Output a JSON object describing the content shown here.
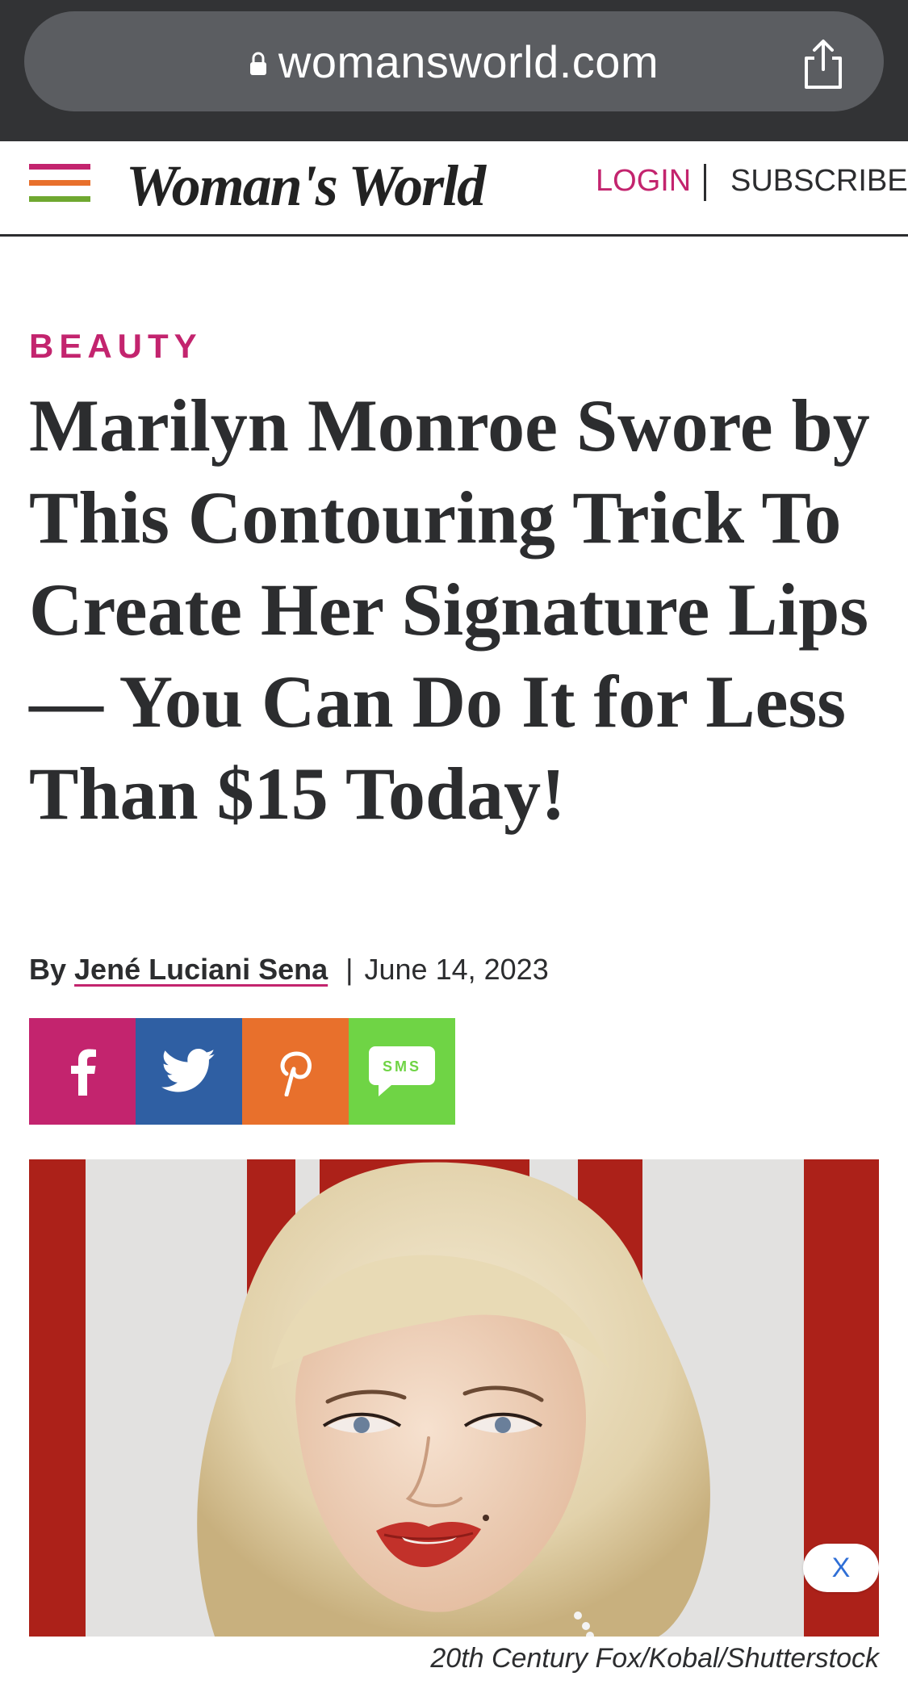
{
  "browser": {
    "url": "womansworld.com",
    "lock_icon": "lock-icon",
    "share_icon": "share-icon"
  },
  "header": {
    "logo": "Woman's World",
    "menu_icon": "hamburger-menu-icon",
    "menu_colors": [
      "#c3246e",
      "#e8702c",
      "#6fa830"
    ],
    "login": "LOGIN",
    "subscribe": "SUBSCRIBE"
  },
  "article": {
    "category": "BEAUTY",
    "headline": "Marilyn Monroe Swore by This Contouring Trick To Create Her Signature Lips — You Can Do It for Less Than $15 Today!",
    "byline_prefix": "By",
    "author": "Jené Luciani Sena",
    "separator": "|",
    "date": "June 14, 2023",
    "image_credit": "20th Century Fox/Kobal/Shutterstock",
    "close_label": "X"
  },
  "share_buttons": [
    {
      "icon": "facebook-icon",
      "color": "#c3246e"
    },
    {
      "icon": "twitter-icon",
      "color": "#2f5fa3"
    },
    {
      "icon": "pinterest-icon",
      "color": "#e8702c"
    },
    {
      "icon": "sms-icon",
      "color": "#6fd445",
      "label": "SMS"
    }
  ],
  "colors": {
    "accent": "#c3246e",
    "text": "#2c2d2f",
    "chrome": "#323335"
  }
}
